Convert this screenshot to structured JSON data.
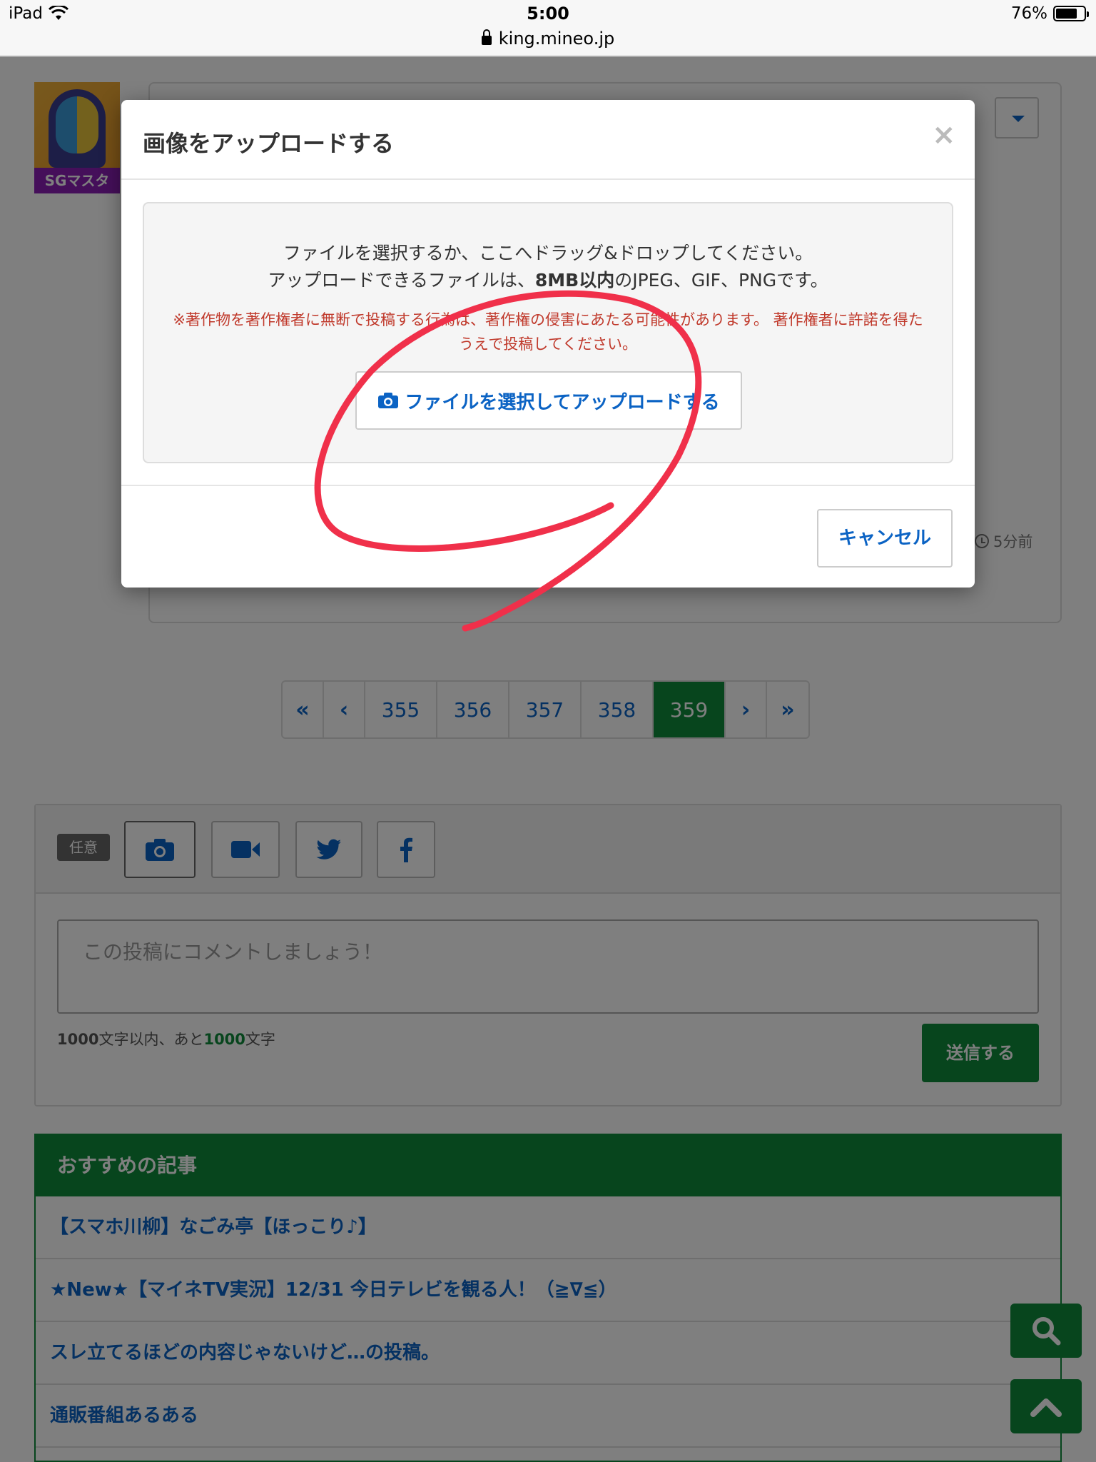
{
  "statusbar": {
    "device": "iPad",
    "time": "5:00",
    "url": "king.mineo.jp",
    "battery": "76%",
    "battery_level": 0.76
  },
  "post": {
    "user_badge": "SGマスタ",
    "time_ago": "5分前"
  },
  "pagination": {
    "first": "«",
    "prev": "‹",
    "pages": [
      "355",
      "356",
      "357",
      "358",
      "359"
    ],
    "current": "359",
    "next": "›",
    "last": "»"
  },
  "comment": {
    "optional_tag": "任意",
    "placeholder": "この投稿にコメントしましょう！",
    "limit_prefix": "1000",
    "limit_middle": "文字以内、あと",
    "limit_remaining": "1000",
    "limit_suffix": "文字",
    "send_label": "送信する",
    "icons": [
      "camera-icon",
      "video-icon",
      "twitter-icon",
      "facebook-icon"
    ]
  },
  "recommended": {
    "title": "おすすめの記事",
    "items": [
      "【スマホ川柳】なごみ亭【ほっこり♪】",
      "★New★【マイネTV実況】12/31 今日テレビを観る人！（≧∇≦）",
      "スレ立てるほどの内容じゃないけど…の投稿。",
      "通販番組あるある"
    ]
  },
  "modal": {
    "title": "画像をアップロードする",
    "close": "×",
    "line1": "ファイルを選択するか、ここへドラッグ&ドロップしてください。",
    "line2_prefix": "アップロードできるファイルは、",
    "line2_bold": "8MB以内",
    "line2_suffix": "のJPEG、GIF、PNGです。",
    "warning": "※著作物を著作権者に無断で投稿する行為は、著作権の侵害にあたる可能性があります。 著作権者に許諾を得たうえで投稿してください。",
    "select_label": "ファイルを選択してアップロードする",
    "cancel_label": "キャンセル"
  },
  "colors": {
    "brand_green": "#0e8a3b",
    "link_blue": "#0b63c4",
    "warning_red": "#c0392b",
    "annotation_red": "#f0304a"
  }
}
